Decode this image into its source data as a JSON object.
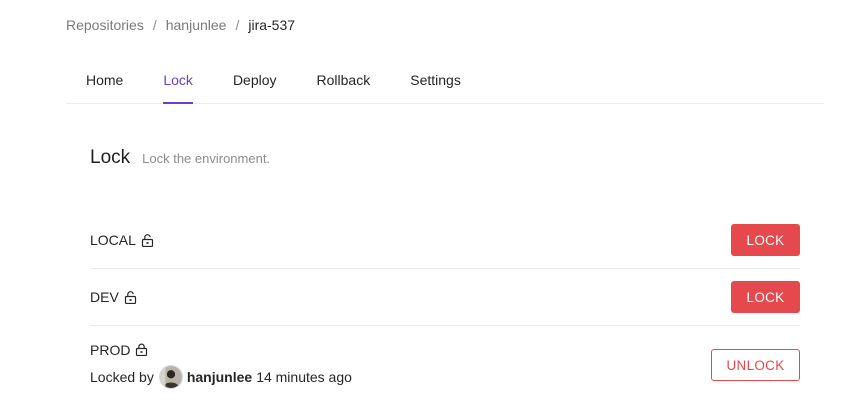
{
  "breadcrumb": {
    "items": [
      "Repositories",
      "hanjunlee",
      "jira-537"
    ],
    "separator": "/"
  },
  "tabs": [
    {
      "label": "Home",
      "active": false
    },
    {
      "label": "Lock",
      "active": true
    },
    {
      "label": "Deploy",
      "active": false
    },
    {
      "label": "Rollback",
      "active": false
    },
    {
      "label": "Settings",
      "active": false
    }
  ],
  "lock_page": {
    "title": "Lock",
    "description": "Lock the environment."
  },
  "environments": [
    {
      "name": "LOCAL",
      "icon": "unlock-icon",
      "button_label": "LOCK"
    },
    {
      "name": "DEV",
      "icon": "unlock-icon",
      "button_label": "LOCK"
    },
    {
      "name": "PROD",
      "icon": "lock-icon",
      "button_label": "UNLOCK",
      "locked_by_prefix": "Locked by",
      "locked_by_user": "hanjunlee",
      "locked_time": "14 minutes ago"
    }
  ],
  "colors": {
    "accent": "#6d3fd0",
    "danger": "#e5484d",
    "divider": "#ececec"
  }
}
